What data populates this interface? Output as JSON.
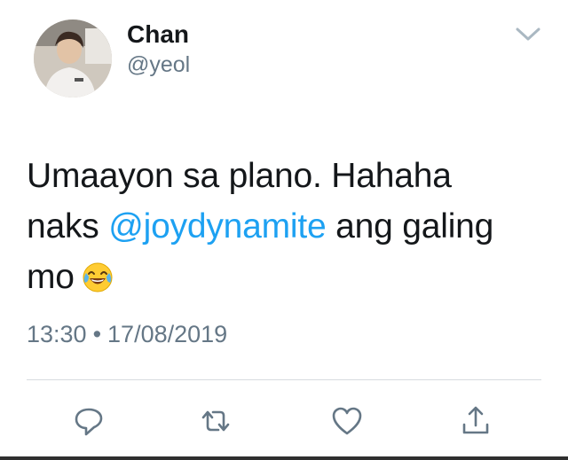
{
  "user": {
    "display_name": "Chan",
    "handle": "@yeol"
  },
  "tweet": {
    "text_line1": "Umaayon sa plano. Hahaha",
    "text_line2_before": "naks ",
    "mention": "@joydynamite",
    "text_line2_after": " ang galing",
    "text_line3": "mo",
    "emoji": "face-with-tears-of-joy",
    "time": "13:30",
    "separator": "•",
    "date": "17/08/2019"
  },
  "actions": [
    "reply-icon",
    "retweet-icon",
    "like-icon",
    "share-icon"
  ],
  "colors": {
    "text": "#14171a",
    "secondary": "#657786",
    "link": "#1da1f2",
    "divider": "#d7dce0"
  }
}
